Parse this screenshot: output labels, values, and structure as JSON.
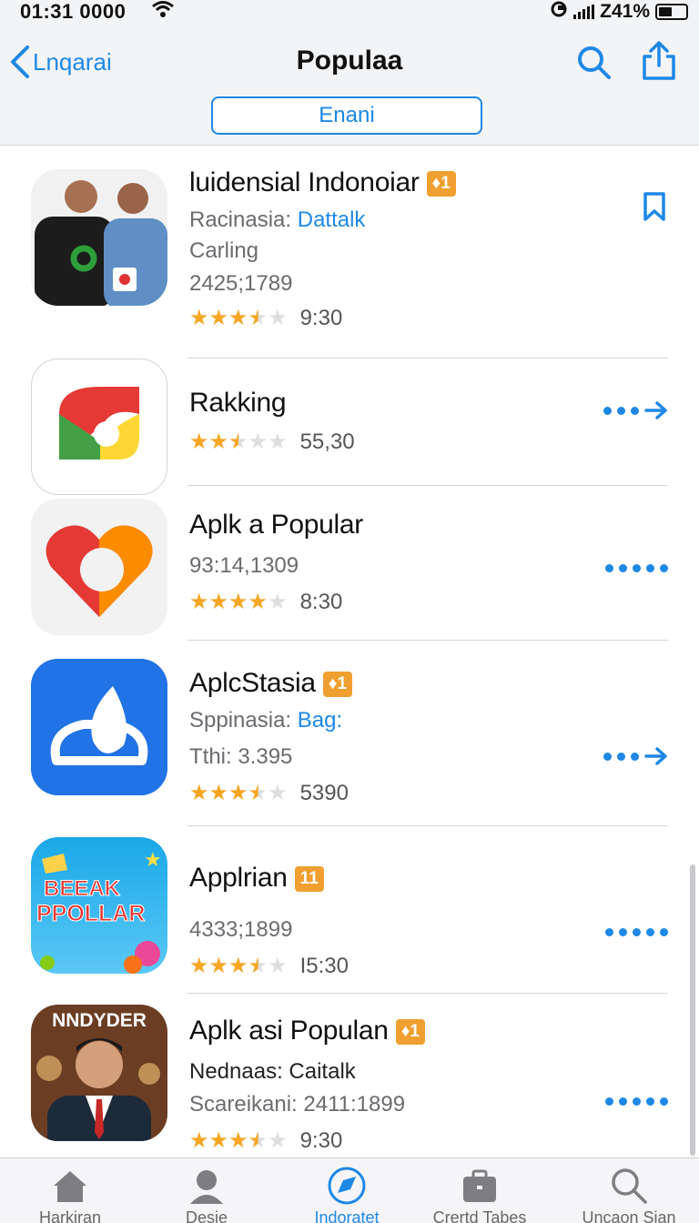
{
  "status": {
    "time": "01:31 0000",
    "battery": "Z41%"
  },
  "nav": {
    "back_label": "Lnqarai",
    "title": "Populaa",
    "segment_label": "Enani"
  },
  "colors": {
    "accent": "#1e88e5",
    "badge": "#f0a030",
    "star": "#f5a623"
  },
  "apps": [
    {
      "title": "luidensial Indonoiar",
      "badge": "1",
      "sub1_label": "Racinasia:",
      "sub1_link": "Dattalk",
      "sub2": "Carling",
      "sub3": "2425;1789",
      "rating_stars": 3.5,
      "rating_text": "9:30",
      "action": "bookmark"
    },
    {
      "title": "Rakking",
      "rating_stars": 2.5,
      "rating_text": "55,30",
      "action": "dots-arrow"
    },
    {
      "title": "Aplk a Popular",
      "sub3": "93:14,1309",
      "rating_stars": 4,
      "rating_text": "8:30",
      "action": "dots"
    },
    {
      "title": "AplcStasia",
      "badge": "1",
      "sub1_label": "Sppinasia:",
      "sub1_link": "Bag:",
      "sub2": "Tthi: 3.395",
      "rating_stars": 3.5,
      "rating_text": "5390",
      "action": "dots-arrow"
    },
    {
      "title": "Applrian",
      "badge": "11",
      "sub3": "4333;1899",
      "rating_stars": 3.5,
      "rating_text": "I5:30",
      "action": "dots",
      "icon_text": [
        "BEEAK",
        "PPOLLAR"
      ]
    },
    {
      "title": "Aplk asi Populan",
      "badge": "1",
      "sub1_label": "Nednaas:",
      "sub1_value": "Caitalk",
      "sub2": "Scareikani: 2411:1899",
      "rating_stars": 3.5,
      "rating_text": "9:30",
      "action": "dots",
      "icon_text": "NNDYDER"
    }
  ],
  "tabs": [
    {
      "label": "Harkiran",
      "icon": "home-icon"
    },
    {
      "label": "Desie",
      "icon": "person-icon"
    },
    {
      "label": "Indoratet",
      "icon": "compass-icon",
      "active": true
    },
    {
      "label": "Crertd Tabes",
      "icon": "briefcase-icon"
    },
    {
      "label": "Uncaon Sian",
      "icon": "search-icon"
    }
  ]
}
